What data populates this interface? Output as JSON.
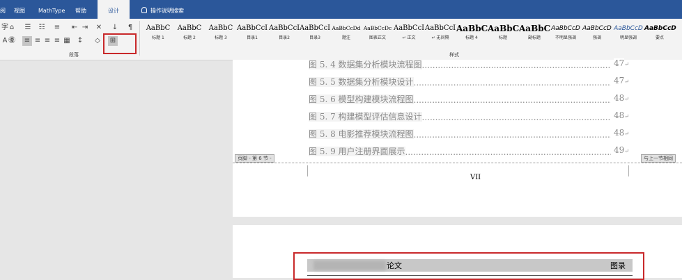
{
  "menu": {
    "items": [
      "阅",
      "视图",
      "MathType",
      "帮助",
      "设计"
    ],
    "search_hint": "操作说明搜索"
  },
  "ribbon": {
    "group_paragraph": "段落",
    "group_styles": "样式",
    "styles": [
      {
        "preview": "AaBbC",
        "name": "标题 1"
      },
      {
        "preview": "AaBbC",
        "name": "标题 2"
      },
      {
        "preview": "AaBbC",
        "name": "标题 3"
      },
      {
        "preview": "AaBbCcI",
        "name": "目录1"
      },
      {
        "preview": "AaBbCcI",
        "name": "目录2"
      },
      {
        "preview": "AaBbCcI",
        "name": "目录3"
      },
      {
        "preview": "AaBbCcDd",
        "name": "题注"
      },
      {
        "preview": "AaBbCcDc",
        "name": "图表正文"
      },
      {
        "preview": "AaBbCcI",
        "name": "↵ 正文"
      },
      {
        "preview": "AaBbCcI",
        "name": "↵ 无间隔"
      },
      {
        "preview": "AaBbC",
        "name": "标题 4"
      },
      {
        "preview": "AaBbC",
        "name": "标题"
      },
      {
        "preview": "AaBbC",
        "name": "副标题"
      },
      {
        "preview": "AaBbCcD",
        "name": "不明显强调"
      },
      {
        "preview": "AaBbCcD",
        "name": "强调"
      },
      {
        "preview": "AaBbCcD",
        "name": "明显强调"
      },
      {
        "preview": "AaBbCcD",
        "name": "要点"
      },
      {
        "preview": "A",
        "name": ""
      }
    ],
    "accent_blue": "#2b579a"
  },
  "document": {
    "toc": [
      {
        "label": "图 5. 4  数据集分析模块流程图",
        "page": "47"
      },
      {
        "label": "图 5. 5  数据集分析模块设计",
        "page": "47"
      },
      {
        "label": "图 5. 6  模型构建模块流程图",
        "page": "48"
      },
      {
        "label": "图 5. 7  构建模型评估信息设计",
        "page": "48"
      },
      {
        "label": "图 5. 8  电影推荐模块流程图",
        "page": "48"
      },
      {
        "label": "图 5. 9  用户注册界面展示",
        "page": "49"
      }
    ],
    "footer_tag": "页脚 - 第 6 节 -",
    "same_as_previous": "与上一节相同",
    "footer_page_number": "VII",
    "header_text_left": "论文",
    "header_text_right": "图录"
  },
  "colors": {
    "highlight_box": "#c8282a"
  }
}
